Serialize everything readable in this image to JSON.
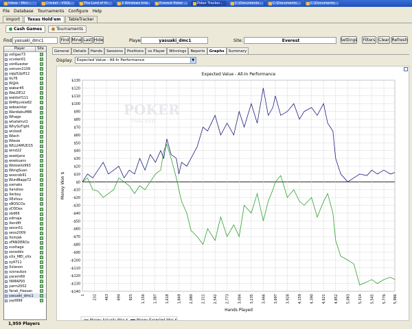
{
  "taskbar": {
    "items": [
      {
        "label": "Inbox - Micr..."
      },
      {
        "label": "Cricket - VSQL..."
      },
      {
        "label": "The Lord of th..."
      },
      {
        "label": "2 Windows Inte..."
      },
      {
        "label": "Everest Poker ..."
      },
      {
        "label": "Poker Tracker..."
      },
      {
        "label": "C:\\Documents..."
      },
      {
        "label": "C:\\Documents..."
      },
      {
        "label": "C:\\Documents..."
      }
    ]
  },
  "menu": [
    "File",
    "Database",
    "Tournaments",
    "Configure",
    "Help"
  ],
  "top_tabs": [
    "Import",
    "Texas Hold'em",
    "TableTracker"
  ],
  "sub_tabs": [
    "Cash Games",
    "Tournaments"
  ],
  "find": {
    "label": "Find:",
    "value": "yasuaki_dmc1",
    "buttons": [
      "Find",
      "Mine",
      "Last",
      "Hide"
    ],
    "player_label": "Player:",
    "player_value": "yasuaki_dmc1",
    "site_label": "Site:",
    "site_value": "Everest",
    "settings": "Settings",
    "filters": "Filters",
    "clear": "Clear",
    "refresh": "Refresh"
  },
  "player_list": {
    "col_player": "Player",
    "col_site": "Site",
    "players": [
      "vollgas73",
      "vcvdan01",
      "vonKuester",
      "vonvon2109",
      "vqip52pff12",
      "Vu76",
      "W@ik",
      "wabar45",
      "WaLDE12",
      "waldorf111",
      "W4ftjunkie82",
      "wdewinter",
      "Wardiebuff86",
      "Whage",
      "whatwhut1",
      "WhySoTight",
      "wickedl",
      "Wiech",
      "Wiesie",
      "WILLIAMUD15",
      "wind22",
      "woekjans",
      "woekuans",
      "Wolowitz993",
      "WongSuan",
      "woocob91",
      "WurdBapp72",
      "xamaks",
      "Xandreo",
      "Xerboy",
      "XEsfxxx",
      "xBOSCOx",
      "xD3Dex",
      "xbd66",
      "xdmaja",
      "Xendlft",
      "xeron51",
      "xeos2009",
      "Xomjak",
      "xFANDEROx",
      "xvoltage",
      "xoneddx",
      "xXx_MEI_xXx",
      "xy4711",
      "Xxlanon",
      "xzxraubzx",
      "yacem69",
      "YAMAP93",
      "yarm2002",
      "Yarak_Hassan",
      "yasuaki_dmc1",
      "yazl999"
    ],
    "selected": "yasuaki_dmc1",
    "count_label": "1,959 Players"
  },
  "panel_tabs": [
    "General",
    "Details",
    "Hands",
    "Sessions",
    "Positions",
    "vs Player",
    "Winnings",
    "Reports",
    "Graphs",
    "Summary"
  ],
  "active_panel_tab": "Graphs",
  "display": {
    "label": "Display:",
    "value": "Expected Value - All-In Performance"
  },
  "chart_data": {
    "type": "line",
    "title": "Expected Value - All-In Performance",
    "xlabel": "Hands Played",
    "ylabel": "Money Won $",
    "xlim": [
      1,
      5986
    ],
    "ylim": [
      -140,
      130
    ],
    "yticks": [
      130,
      120,
      110,
      100,
      90,
      80,
      70,
      60,
      50,
      40,
      30,
      20,
      10,
      0,
      -10,
      -20,
      -30,
      -40,
      -50,
      -60,
      -70,
      -80,
      -90,
      -100,
      -110,
      -120,
      -130,
      -140
    ],
    "xticks": [
      1,
      232,
      463,
      694,
      925,
      1156,
      1387,
      1618,
      1849,
      2080,
      2311,
      2542,
      2773,
      3004,
      3235,
      3466,
      3697,
      3928,
      4159,
      4390,
      4621,
      4852,
      5083,
      5314,
      5545,
      5776,
      5986
    ],
    "grid": true,
    "legend_position": "bottom-left",
    "series": [
      {
        "name": "Money Actually Won $",
        "color": "#2ca02c",
        "x": [
          1,
          100,
          200,
          300,
          400,
          500,
          600,
          700,
          800,
          900,
          1000,
          1100,
          1200,
          1300,
          1400,
          1500,
          1560,
          1618,
          1700,
          1800,
          1849,
          1900,
          2000,
          2080,
          2200,
          2311,
          2400,
          2542,
          2650,
          2773,
          2900,
          3004,
          3100,
          3235,
          3350,
          3466,
          3560,
          3650,
          3697,
          3800,
          3928,
          4050,
          4159,
          4250,
          4390,
          4500,
          4621,
          4700,
          4800,
          4852,
          4950,
          5083,
          5200,
          5314,
          5450,
          5545,
          5650,
          5776,
          5900,
          5986
        ],
        "y": [
          0,
          5,
          -10,
          -12,
          -20,
          -15,
          -10,
          5,
          0,
          -5,
          -15,
          -5,
          -10,
          0,
          10,
          15,
          40,
          48,
          30,
          5,
          -10,
          -25,
          -40,
          -62,
          -70,
          -80,
          -60,
          -75,
          -45,
          -70,
          -55,
          -70,
          -30,
          -40,
          -15,
          -50,
          -25,
          -10,
          0,
          8,
          -20,
          -10,
          -25,
          -30,
          -20,
          -45,
          -25,
          -15,
          -40,
          -75,
          -95,
          -100,
          -105,
          -132,
          -128,
          -125,
          -130,
          -125,
          -122,
          -125
        ]
      },
      {
        "name": "Money Expected Won $",
        "color": "#1c1c7c",
        "x": [
          1,
          100,
          200,
          300,
          400,
          500,
          600,
          700,
          800,
          900,
          1000,
          1100,
          1200,
          1300,
          1400,
          1500,
          1560,
          1618,
          1700,
          1800,
          1849,
          1900,
          2000,
          2080,
          2200,
          2311,
          2400,
          2542,
          2650,
          2773,
          2900,
          3004,
          3100,
          3235,
          3350,
          3466,
          3560,
          3650,
          3697,
          3800,
          3928,
          4050,
          4159,
          4250,
          4390,
          4500,
          4621,
          4700,
          4800,
          4852,
          4950,
          5083,
          5200,
          5314,
          5450,
          5545,
          5650,
          5776,
          5900,
          5986
        ],
        "y": [
          0,
          10,
          5,
          15,
          25,
          10,
          15,
          20,
          5,
          15,
          10,
          30,
          15,
          35,
          25,
          40,
          30,
          55,
          35,
          30,
          10,
          25,
          20,
          30,
          45,
          70,
          65,
          85,
          60,
          75,
          60,
          90,
          70,
          100,
          75,
          120,
          85,
          95,
          110,
          85,
          90,
          100,
          80,
          90,
          95,
          85,
          100,
          75,
          65,
          30,
          10,
          0,
          5,
          10,
          8,
          15,
          10,
          15,
          10,
          12
        ]
      }
    ]
  }
}
